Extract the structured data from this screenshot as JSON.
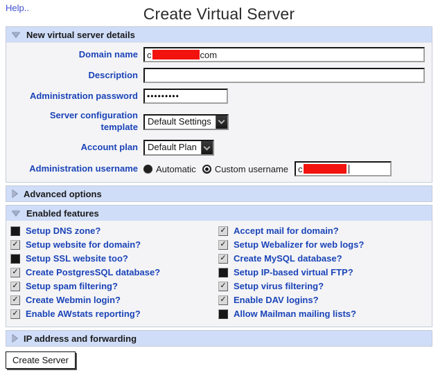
{
  "page": {
    "help_link": "Help..",
    "title": "Create Virtual Server"
  },
  "sections": {
    "details": {
      "title": "New virtual server details",
      "expanded": true
    },
    "advanced": {
      "title": "Advanced options",
      "expanded": false
    },
    "features": {
      "title": "Enabled features",
      "expanded": true
    },
    "ip": {
      "title": "IP address and forwarding",
      "expanded": false
    }
  },
  "fields": {
    "domain": {
      "label": "Domain name",
      "value_prefix": "c",
      "value_suffix": "com",
      "redacted": true
    },
    "description": {
      "label": "Description",
      "value": ""
    },
    "password": {
      "label": "Administration password",
      "masked_value": "•••••••••"
    },
    "template": {
      "label": "Server configuration template",
      "selected": "Default Settings"
    },
    "plan": {
      "label": "Account plan",
      "selected": "Default Plan"
    },
    "username": {
      "label": "Administration username",
      "automatic_label": "Automatic",
      "automatic_selected": false,
      "custom_label": "Custom username",
      "custom_selected": true,
      "value_prefix": "c",
      "redacted": true
    }
  },
  "features": {
    "left": [
      {
        "label": "Setup DNS zone?",
        "checked": false
      },
      {
        "label": "Setup website for domain?",
        "checked": true
      },
      {
        "label": "Setup SSL website too?",
        "checked": false
      },
      {
        "label": "Create PostgresSQL database?",
        "checked": true
      },
      {
        "label": "Setup spam filtering?",
        "checked": true
      },
      {
        "label": "Create Webmin login?",
        "checked": true
      },
      {
        "label": "Enable AWstats reporting?",
        "checked": true
      }
    ],
    "right": [
      {
        "label": "Accept mail for domain?",
        "checked": true
      },
      {
        "label": "Setup Webalizer for web logs?",
        "checked": true
      },
      {
        "label": "Create MySQL database?",
        "checked": true
      },
      {
        "label": "Setup IP-based virtual FTP?",
        "checked": false
      },
      {
        "label": "Setup virus filtering?",
        "checked": true
      },
      {
        "label": "Enable DAV logins?",
        "checked": true
      },
      {
        "label": "Allow Mailman mailing lists?",
        "checked": false
      }
    ]
  },
  "actions": {
    "create_server": "Create Server"
  },
  "colors": {
    "header_bg": "#cfddf8",
    "label_blue": "#1b44b8",
    "link_blue": "#3d4ed0",
    "redaction_red": "#f2130e"
  }
}
